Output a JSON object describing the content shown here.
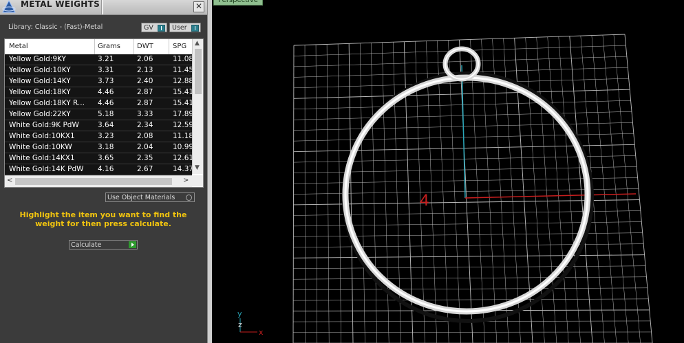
{
  "panel": {
    "title": "METAL WEIGHTS",
    "close_label": "✕",
    "library_label": "Library: Classic - (Fast)-Metal",
    "gv_label": "GV",
    "user_label": "User",
    "columns": [
      "Metal",
      "Grams",
      "DWT",
      "SPG"
    ],
    "rows": [
      [
        "Yellow Gold:9KY",
        "3.21",
        "2.06",
        "11.08"
      ],
      [
        "Yellow Gold:10KY",
        "3.31",
        "2.13",
        "11.45"
      ],
      [
        "Yellow Gold:14KY",
        "3.73",
        "2.40",
        "12.88"
      ],
      [
        "Yellow Gold:18KY",
        "4.46",
        "2.87",
        "15.41"
      ],
      [
        "Yellow Gold:18KY R...",
        "4.46",
        "2.87",
        "15.41"
      ],
      [
        "Yellow Gold:22KY",
        "5.18",
        "3.33",
        "17.89"
      ],
      [
        "White Gold:9K PdW",
        "3.64",
        "2.34",
        "12.59"
      ],
      [
        "White Gold:10KX1",
        "3.23",
        "2.08",
        "11.18"
      ],
      [
        "White Gold:10KW",
        "3.18",
        "2.04",
        "10.99"
      ],
      [
        "White Gold:14KX1",
        "3.65",
        "2.35",
        "12.61"
      ],
      [
        "White Gold:14K PdW",
        "4.16",
        "2.67",
        "14.37"
      ]
    ],
    "use_object_materials": "Use Object Materials",
    "hint": "Highlight the item you want to find the weight for then press calculate.",
    "calculate_label": "Calculate"
  },
  "viewport": {
    "tab_label": "Perspective",
    "grid_label": "4",
    "axis_y": "y",
    "axis_z": "z",
    "axis_x": "x",
    "colors": {
      "x_axis": "#c81e1e",
      "y_axis": "#2aa6b8",
      "grid": "#bdbdbd",
      "highlight_text": "#f1c40f"
    }
  }
}
